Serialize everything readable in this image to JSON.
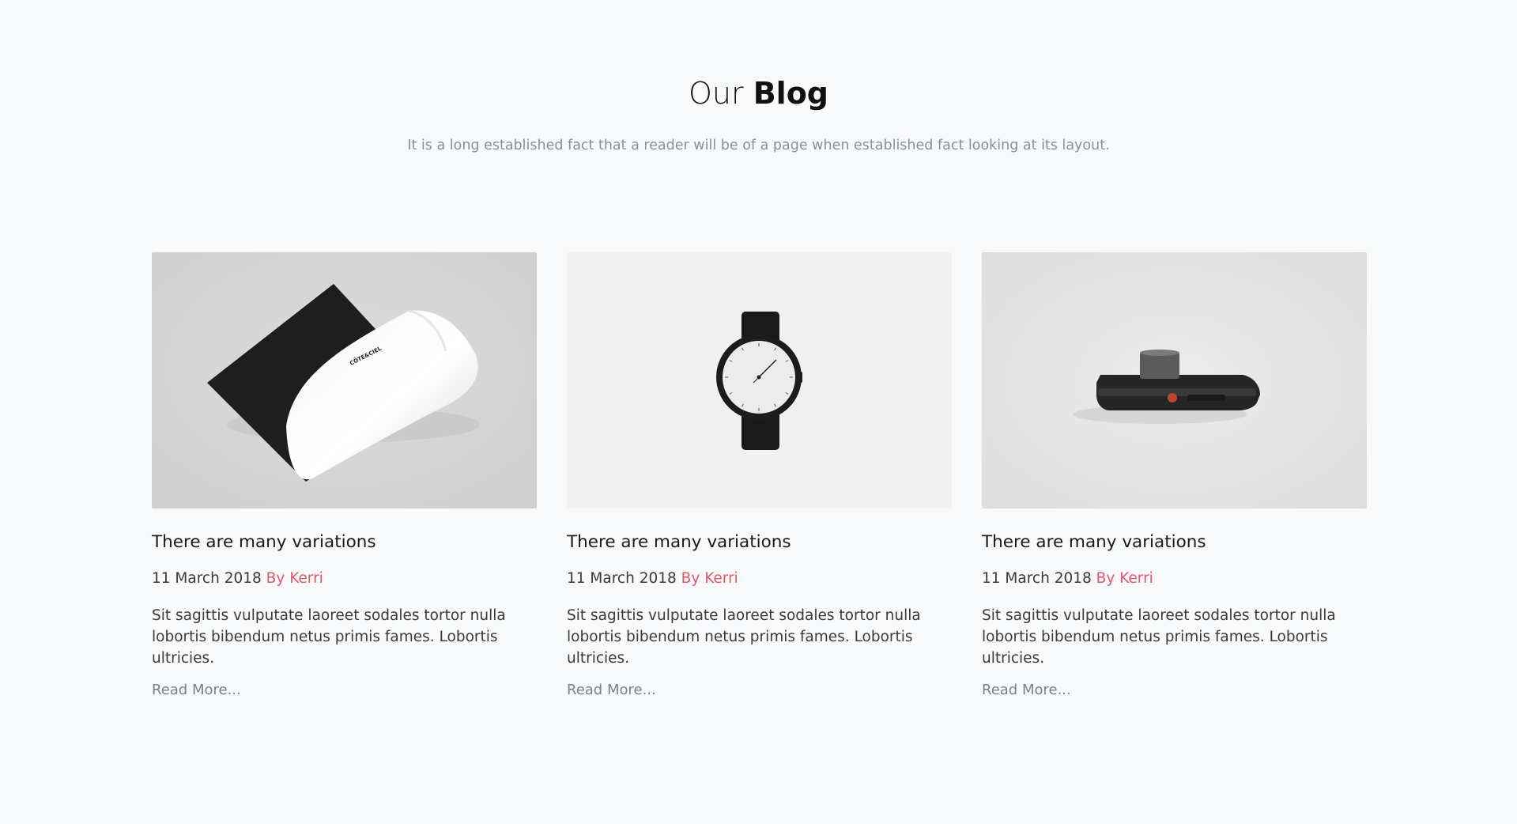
{
  "blog": {
    "heading_light": "Our",
    "heading_bold": "Blog",
    "subtitle": "It is a long established fact that a reader will be of a page when established fact looking at its layout."
  },
  "posts": [
    {
      "title": "There are many variations",
      "date": "11 March 2018",
      "author": "By Kerri",
      "excerpt": "Sit sagittis vulputate laoreet sodales tortor nulla lobortis bibendum netus primis fames. Lobortis ultricies.",
      "read_more": "Read More...",
      "image_icon": "envelope-mockup-image",
      "brand_mark": "CÔTE&CIEL"
    },
    {
      "title": "There are many variations",
      "date": "11 March 2018",
      "author": "By Kerri",
      "excerpt": "Sit sagittis vulputate laoreet sodales tortor nulla lobortis bibendum netus primis fames. Lobortis ultricies.",
      "read_more": "Read More...",
      "image_icon": "wristwatch-image"
    },
    {
      "title": "There are many variations",
      "date": "11 March 2018",
      "author": "By Kerri",
      "excerpt": "Sit sagittis vulputate laoreet sodales tortor nulla lobortis bibendum netus primis fames. Lobortis ultricies.",
      "read_more": "Read More...",
      "image_icon": "instant-camera-image"
    }
  ],
  "colors": {
    "background": "#f8f9fa",
    "author_accent": "#e0586c",
    "muted_text": "#8a8f97",
    "body_text": "#3a3a3a"
  }
}
